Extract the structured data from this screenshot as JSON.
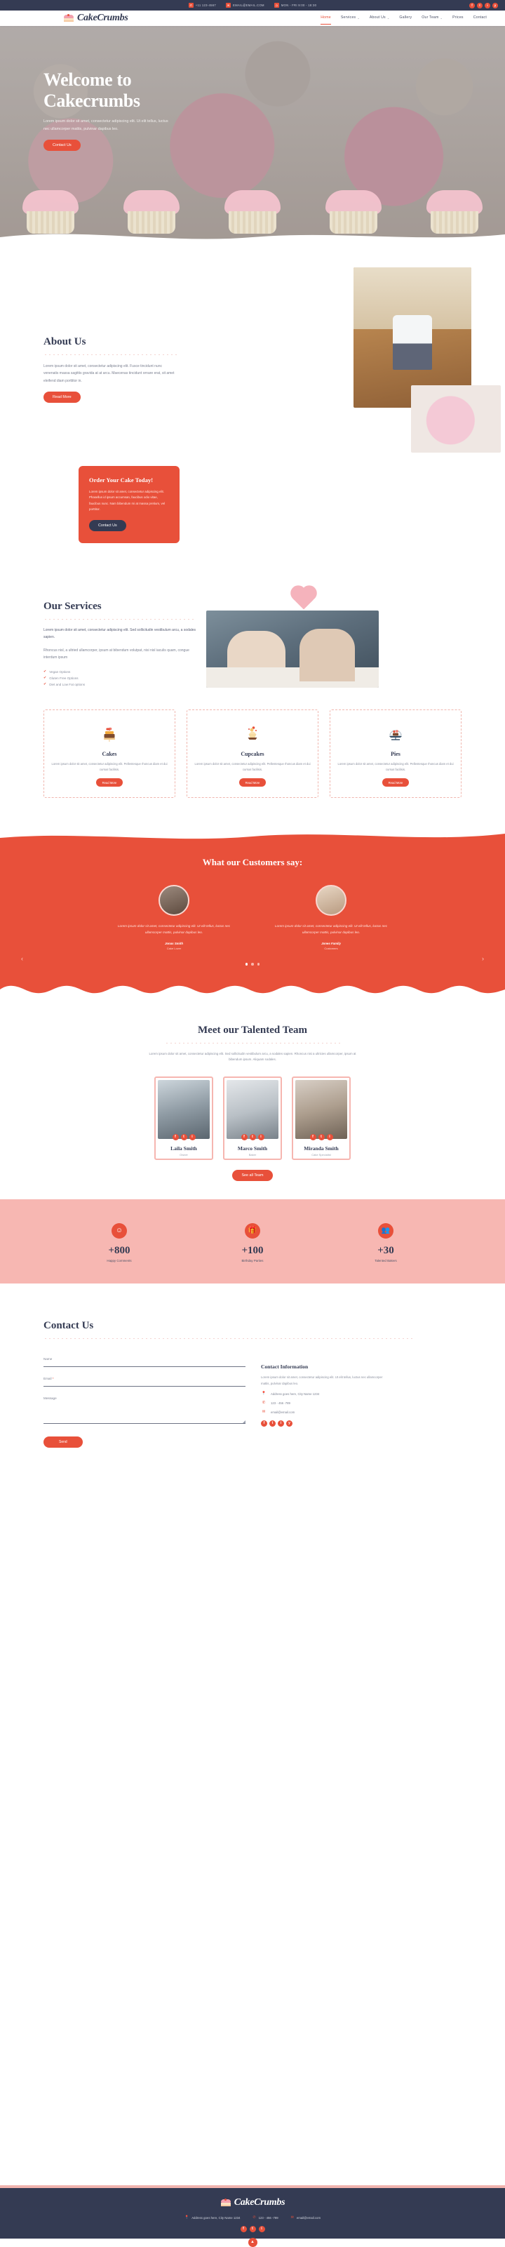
{
  "topbar": {
    "phone": "+11 123-4567",
    "email": "EMAIL@EMAIL.COM",
    "hours": "MON - FRI 9:00 - 18:30",
    "socials": [
      "f",
      "t",
      "i",
      "y"
    ]
  },
  "brand": {
    "name": "CakeCrumbs"
  },
  "nav": {
    "items": [
      {
        "label": "Home",
        "caret": "",
        "active": true
      },
      {
        "label": "Services",
        "caret": "⌄",
        "active": false
      },
      {
        "label": "About Us",
        "caret": "⌄",
        "active": false
      },
      {
        "label": "Gallery",
        "caret": "",
        "active": false
      },
      {
        "label": "Our Team",
        "caret": "⌄",
        "active": false
      },
      {
        "label": "Prices",
        "caret": "",
        "active": false
      },
      {
        "label": "Contact",
        "caret": "",
        "active": false
      }
    ]
  },
  "hero": {
    "title_line1": "Welcome to",
    "title_line2": "Cakecrumbs",
    "subtitle": "Lorem ipsum dolor sit amet, consectetur adipiscing elit. Ut elit tellus, luctus nec ullamcorper mattis, pulvinar dapibus leo.",
    "cta": "Contact Us"
  },
  "about": {
    "title": "About Us",
    "body": "Lorem ipsum dolor sit amet, consectetur adipiscing elit. Fusce tincidunt nunc venenatis massa sagittis gravida at at arcu. Maecenas tincidunt ornare erat, sit amet eleifend diam porttitor in.",
    "cta": "Read More"
  },
  "order": {
    "title": "Order Your Cake Today!",
    "body": "Lorem ipsum dolor sit amet, consectetur adipiscing elit. Phasellus id ipsum accumsan, faucibus odio vitae, faucibus nunc. Nam bibendum mi at massa pretium, vel porttitor.",
    "cta": "Contact Us"
  },
  "services": {
    "title": "Our Services",
    "lead": "Lorem ipsum dolor sit amet, consectetur adipiscing elit. Sed sollicitudin vestibulum arcu, a sodales sapien.",
    "body": "Rhoncus nisl, a ultried ullamcorper, ipsum at bibendum volutpat, nisi nisl iaculis quam, congue interdum ipsum",
    "checklist": [
      "Vegan Options",
      "Gluten Free Options",
      "Diet and Low Fat options"
    ],
    "cards": [
      {
        "icon": "layer-cake-icon",
        "title": "Cakes",
        "body": "Lorem ipsum dolor sit amet, consectetur adipiscing elit. Pellentesque rhoncus diam et dui cursus facilisis.",
        "cta": "Read More"
      },
      {
        "icon": "cupcake-icon",
        "title": "Cupcakes",
        "body": "Lorem ipsum dolor sit amet, consectetur adipiscing elit. Pellentesque rhoncus diam et dui cursus facilisis.",
        "cta": "Read More"
      },
      {
        "icon": "pie-dome-icon",
        "title": "Pies",
        "body": "Lorem ipsum dolor sit amet, consectetur adipiscing elit. Pellentesque rhoncus diam et dui cursus facilisis.",
        "cta": "Read More"
      }
    ]
  },
  "testimonials": {
    "title": "What our Customers say:",
    "prev": "‹",
    "next": "›",
    "items": [
      {
        "quote": "Lorem ipsum dolor sit amet, consectetur adipiscing elit. Ut elit tellus, luctus nec ullamcorper mattis, pulvinar dapibus leo.",
        "name": "Jonas Smith",
        "role": "Cake Lover"
      },
      {
        "quote": "Lorem ipsum dolor sit amet, consectetur adipiscing elit. Ut elit tellus, luctus nec ullamcorper mattis, pulvinar dapibus leo.",
        "name": "Jones Family",
        "role": "Customers"
      }
    ]
  },
  "team": {
    "title": "Meet our Talented Team",
    "lead": "Lorem ipsum dolor sit amet, consectetur adipiscing elit. Sed sollicitudin vestibulum arcu, a sodales sapien. Rhoncus nisi a ultricies ullamcorper, ipsum at bibendum ipsum. Aliquam sodales.",
    "members": [
      {
        "name": "Laila Smith",
        "role": "Owner",
        "socials": [
          "f",
          "t",
          "i"
        ]
      },
      {
        "name": "Marco Smith",
        "role": "Baker",
        "socials": [
          "f",
          "t",
          "i"
        ]
      },
      {
        "name": "Miranda Smith",
        "role": "Cake Specialist",
        "socials": [
          "f",
          "t",
          "i"
        ]
      }
    ],
    "cta": "See all Team"
  },
  "stats": {
    "items": [
      {
        "icon": "comment-icon",
        "glyph": "✆",
        "number": "+800",
        "label": "Happy Comments"
      },
      {
        "icon": "gift-icon",
        "glyph": "🎁",
        "number": "+100",
        "label": "Birthday Parties"
      },
      {
        "icon": "people-icon",
        "glyph": "👥",
        "number": "+30",
        "label": "Talented Bakers"
      }
    ]
  },
  "contact": {
    "title": "Contact Us",
    "fields": {
      "name_label": "Name",
      "email_label": "Email",
      "email_required": "*",
      "message_label": "Message"
    },
    "submit": "Send",
    "info_title": "Contact Information",
    "info_body": "Lorem ipsum dolor sit amet, consectetur adipiscing elit. Ut elit tellus, luctus nec ullamcorper mattis, pulvinar dapibus leo.",
    "address": "Address goes here, City Name 1234",
    "phone": "123 - 456 -789",
    "email": "email@email.com",
    "socials": [
      "f",
      "t",
      "i",
      "y"
    ]
  },
  "footer": {
    "brand": "CakeCrumbs",
    "address": "Address goes here, City Name 1234",
    "phone": "123 - 456 -789",
    "email": "email@email.com",
    "socials": [
      "f",
      "t",
      "i"
    ],
    "back_to_top": "▲"
  },
  "colors": {
    "accent": "#e8503a",
    "dark": "#343b53",
    "pink": "#f7b7b2"
  }
}
